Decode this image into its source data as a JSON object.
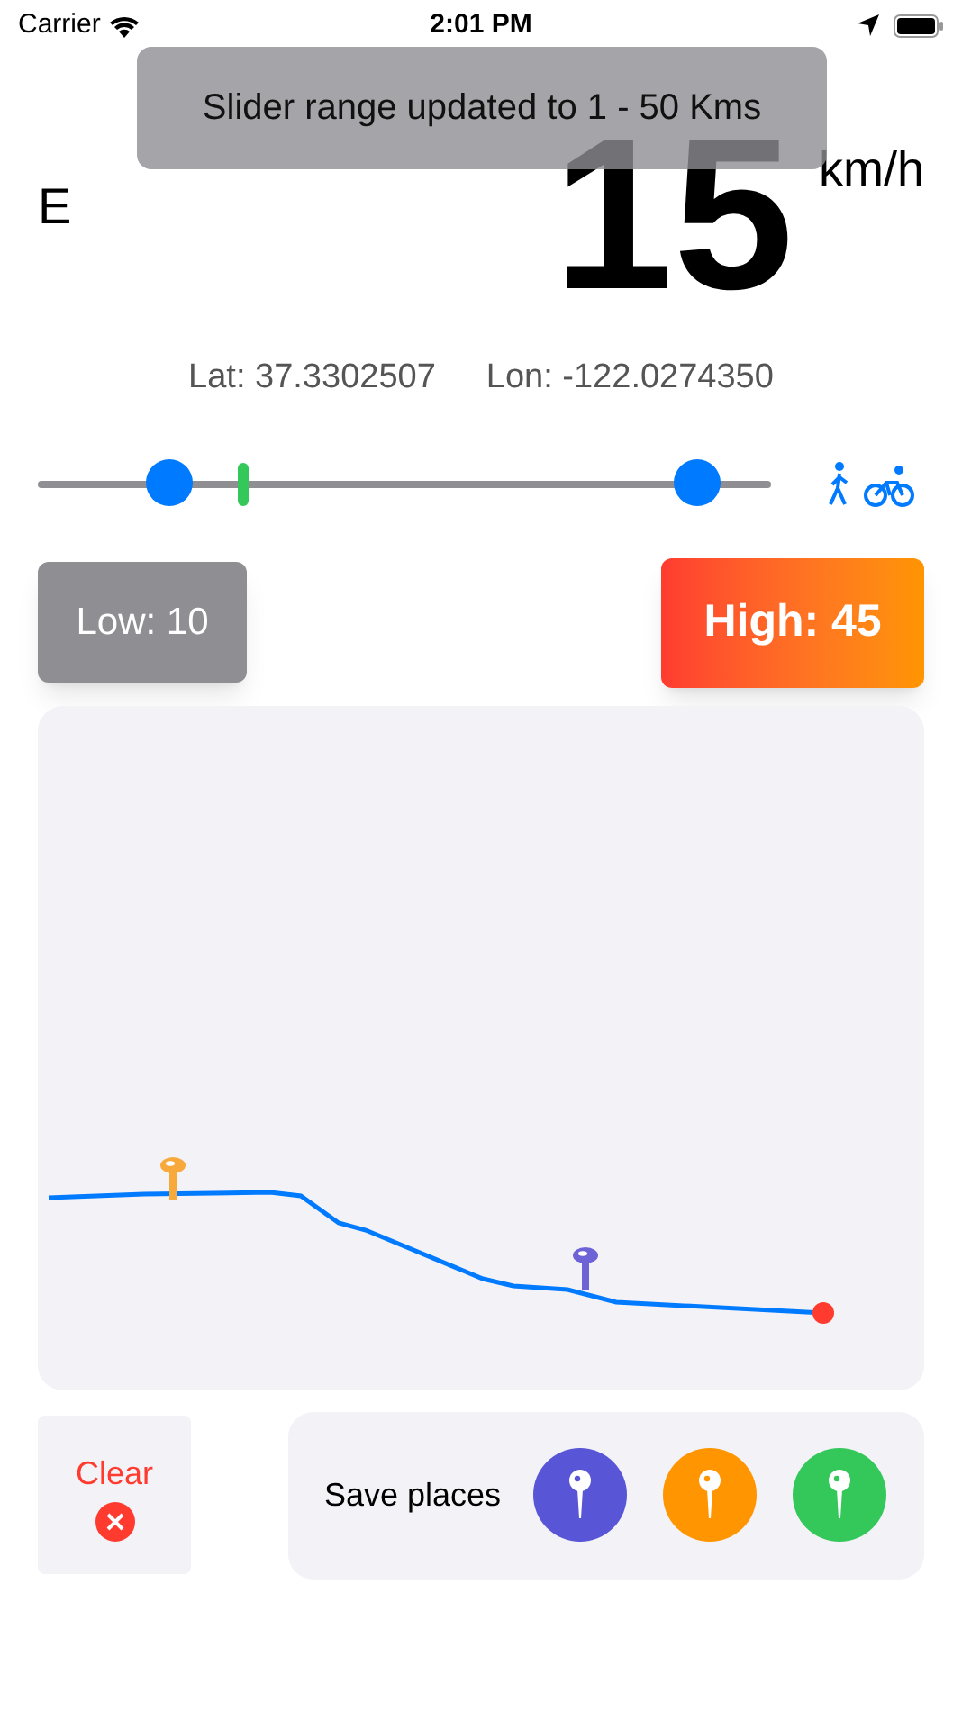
{
  "status_bar": {
    "carrier": "Carrier",
    "time": "2:01 PM"
  },
  "toast": {
    "message": "Slider range updated to 1 - 50 Kms"
  },
  "speed": {
    "direction": "E",
    "value": "15",
    "unit": "km/h"
  },
  "location": {
    "lat": "Lat: 37.3302507",
    "lon": "Lon: -122.0274350"
  },
  "range_slider": {
    "thumbs": [
      {
        "level": 0.18
      },
      {
        "level": 0.9
      }
    ],
    "marker": {
      "level": 0.28
    }
  },
  "low_button": {
    "label": "Low: 10"
  },
  "high_button": {
    "label": "High: 45"
  },
  "route": {
    "pins": [
      {
        "color": "#f7a93b"
      },
      {
        "color": "#6e63d6"
      }
    ]
  },
  "clear_button": {
    "label": "Clear"
  },
  "save_places": {
    "label": "Save places",
    "buttons": [
      {
        "color": "#5856d6"
      },
      {
        "color": "#ff9500"
      },
      {
        "color": "#34c759"
      }
    ]
  }
}
